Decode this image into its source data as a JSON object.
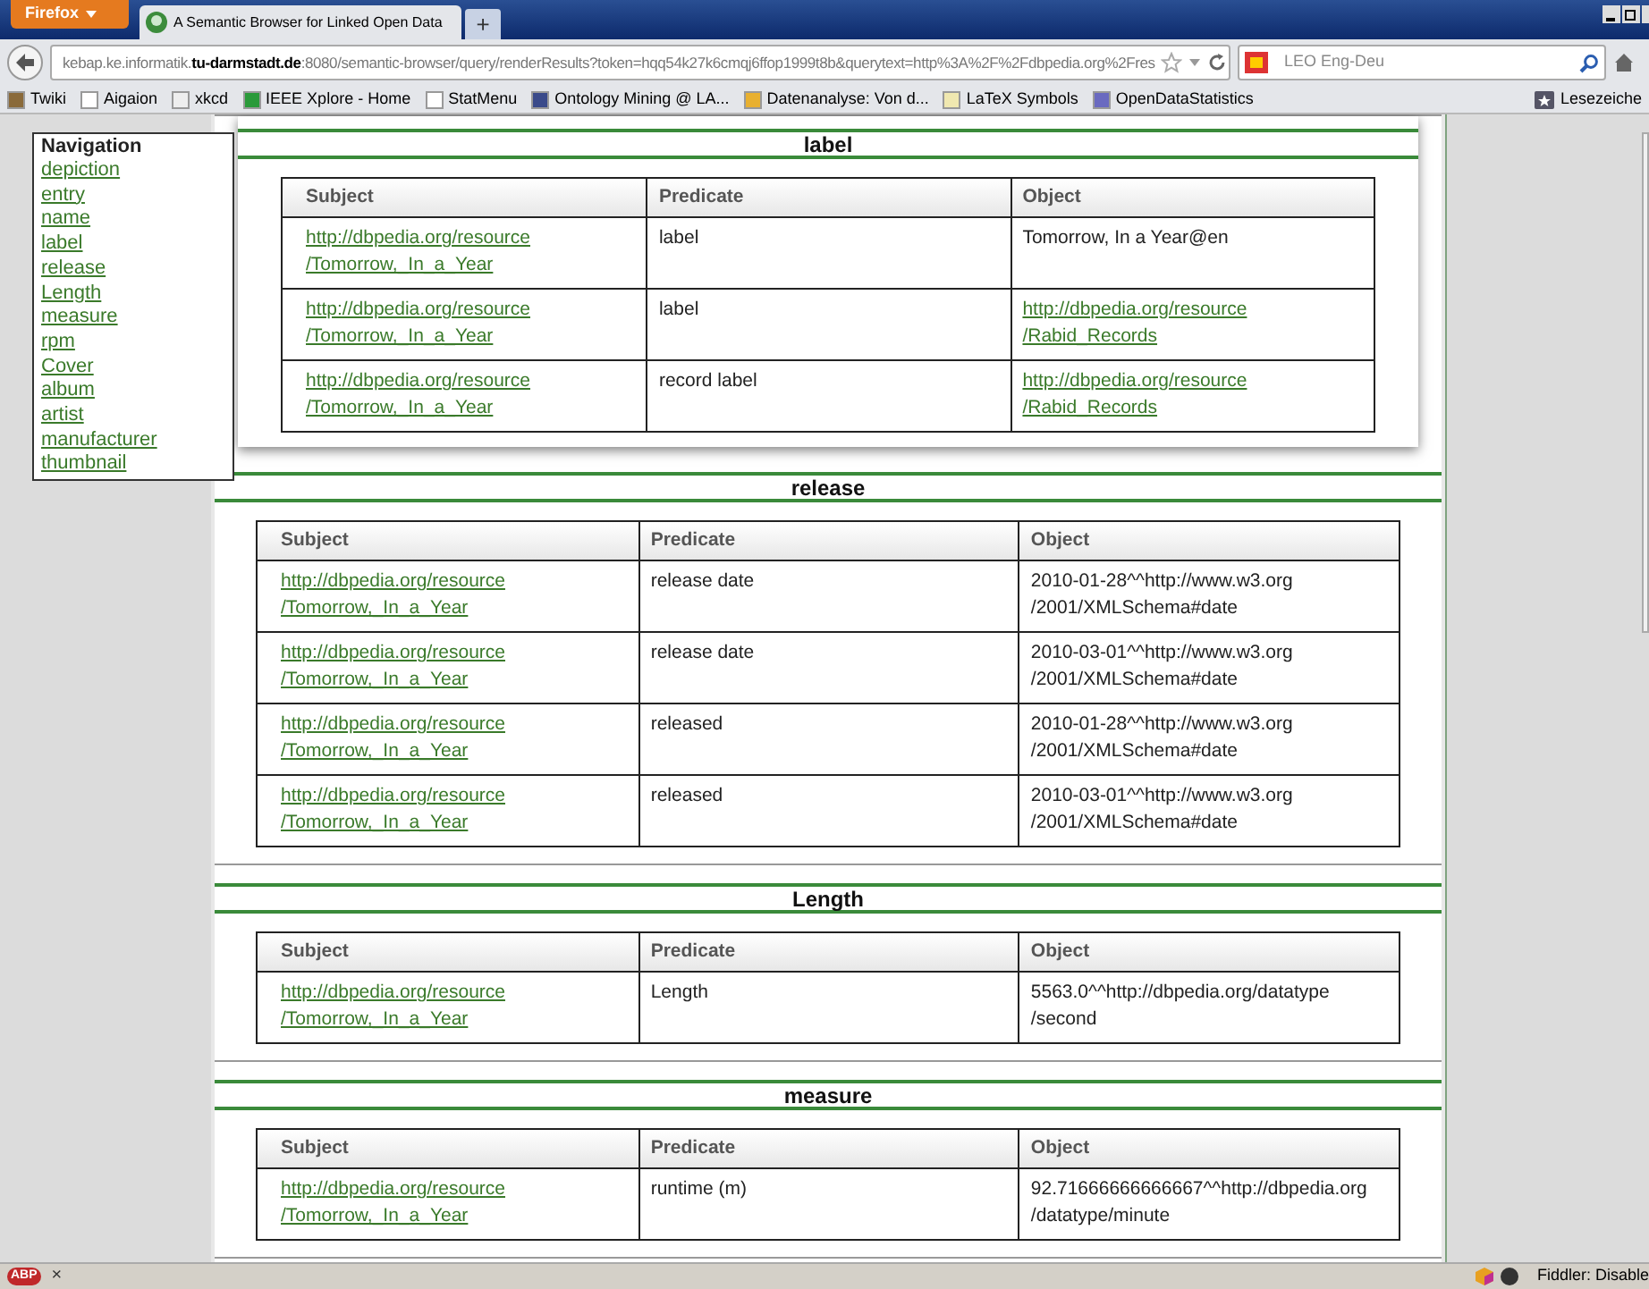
{
  "browser": {
    "menu_button": "Firefox",
    "tabs": [
      {
        "title": "A Semantic Browser for Linked Open Data",
        "selected": true
      }
    ],
    "new_tab": "+",
    "url": "kebap.ke.informatik.**tu-darmstadt.de**:8080/semantic-browser/query/renderResults?token=hqq54k27k6cmqj6ffop1999t8b&querytext=http%3A%2F%2Fdbpedia.org%2Fres",
    "search_placeholder": "LEO Eng-Deu",
    "bookmarks": [
      "Twiki",
      "Aigaion",
      "xkcd",
      "IEEE Xplore - Home",
      "StatMenu",
      "Ontology Mining @ LA...",
      "Datenanalyse: Von d...",
      "LaTeX Symbols",
      "OpenDataStatistics"
    ],
    "bookmarks_menu": "Lesezeiche"
  },
  "navigation": {
    "title": "Navigation",
    "links": [
      "depiction",
      "entry",
      "name",
      "label",
      "release",
      "Length",
      "measure",
      "rpm",
      "Cover",
      "album",
      "artist",
      "manufacturer",
      "thumbnail"
    ]
  },
  "sections": [
    {
      "title": "label",
      "highlighted": true,
      "columns": [
        "Subject",
        "Predicate",
        "Object"
      ],
      "rows": [
        {
          "subject": [
            "http://dbpedia.org/resource",
            "/Tomorrow,_In_a_Year"
          ],
          "predicate": "label",
          "object": [
            "Tomorrow, In a Year@en"
          ],
          "object_linked": false
        },
        {
          "subject": [
            "http://dbpedia.org/resource",
            "/Tomorrow,_In_a_Year"
          ],
          "predicate": "label",
          "object": [
            "http://dbpedia.org/resource",
            "/Rabid_Records"
          ],
          "object_linked": true
        },
        {
          "subject": [
            "http://dbpedia.org/resource",
            "/Tomorrow,_In_a_Year"
          ],
          "predicate": "record label",
          "object": [
            "http://dbpedia.org/resource",
            "/Rabid_Records"
          ],
          "object_linked": true
        }
      ]
    },
    {
      "title": "release",
      "highlighted": false,
      "columns": [
        "Subject",
        "Predicate",
        "Object"
      ],
      "rows": [
        {
          "subject": [
            "http://dbpedia.org/resource",
            "/Tomorrow,_In_a_Year"
          ],
          "predicate": "release date",
          "object": [
            "2010-01-28^^http://www.w3.org",
            "/2001/XMLSchema#date"
          ],
          "object_linked": false
        },
        {
          "subject": [
            "http://dbpedia.org/resource",
            "/Tomorrow,_In_a_Year"
          ],
          "predicate": "release date",
          "object": [
            "2010-03-01^^http://www.w3.org",
            "/2001/XMLSchema#date"
          ],
          "object_linked": false
        },
        {
          "subject": [
            "http://dbpedia.org/resource",
            "/Tomorrow,_In_a_Year"
          ],
          "predicate": "released",
          "object": [
            "2010-01-28^^http://www.w3.org",
            "/2001/XMLSchema#date"
          ],
          "object_linked": false
        },
        {
          "subject": [
            "http://dbpedia.org/resource",
            "/Tomorrow,_In_a_Year"
          ],
          "predicate": "released",
          "object": [
            "2010-03-01^^http://www.w3.org",
            "/2001/XMLSchema#date"
          ],
          "object_linked": false
        }
      ]
    },
    {
      "title": "Length",
      "highlighted": false,
      "columns": [
        "Subject",
        "Predicate",
        "Object"
      ],
      "rows": [
        {
          "subject": [
            "http://dbpedia.org/resource",
            "/Tomorrow,_In_a_Year"
          ],
          "predicate": "Length",
          "object": [
            "5563.0^^http://dbpedia.org/datatype",
            "/second"
          ],
          "object_linked": false
        }
      ]
    },
    {
      "title": "measure",
      "highlighted": false,
      "columns": [
        "Subject",
        "Predicate",
        "Object"
      ],
      "rows": [
        {
          "subject": [
            "http://dbpedia.org/resource",
            "/Tomorrow,_In_a_Year"
          ],
          "predicate": "runtime (m)",
          "object": [
            "92.71666666666667^^http://dbpedia.org",
            "/datatype/minute"
          ],
          "object_linked": false
        }
      ]
    }
  ],
  "status_bar": {
    "addon": "ABP",
    "close": "×",
    "fiddler": "Fiddler: Disable"
  }
}
